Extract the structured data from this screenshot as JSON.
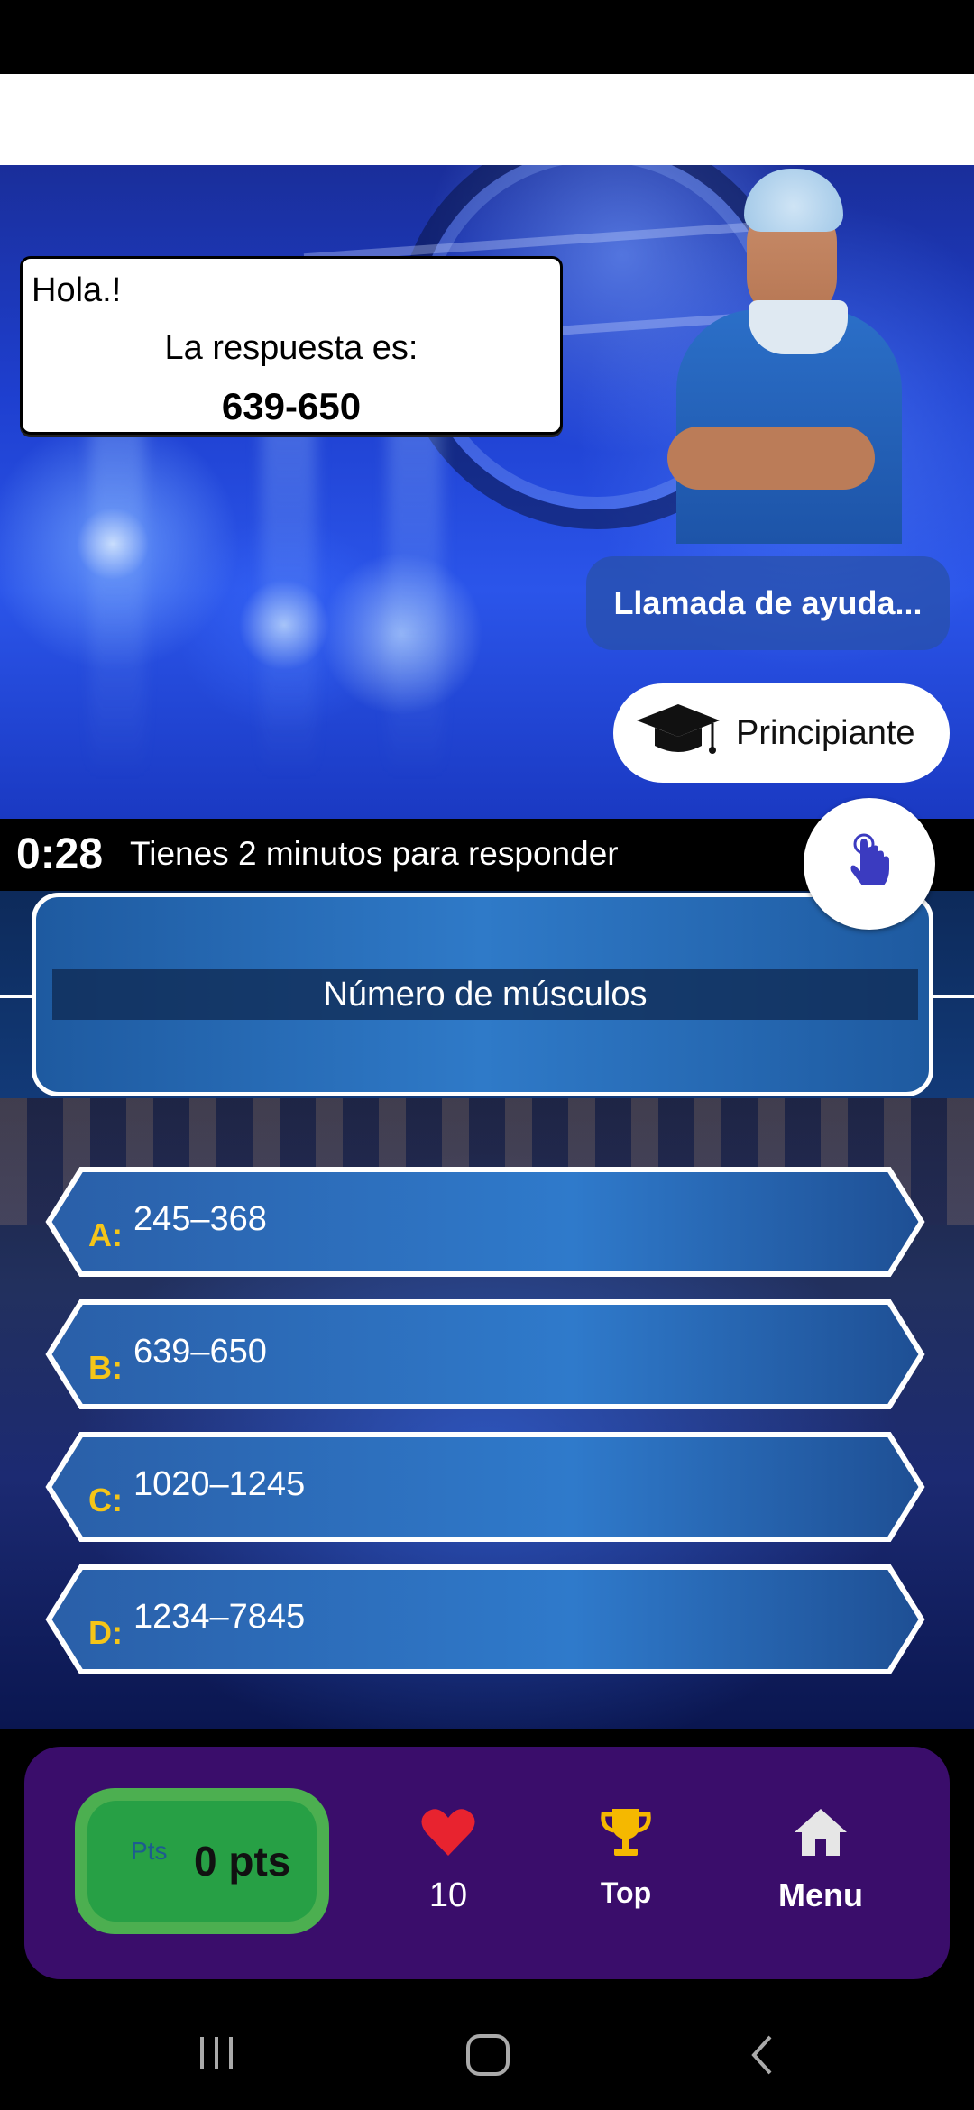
{
  "dialog": {
    "greeting": "Hola.!",
    "prompt": "La respuesta es:",
    "answer": "639-650"
  },
  "help_button_label": "Llamada de ayuda...",
  "level": {
    "icon": "graduation-cap-icon",
    "label": "Principiante"
  },
  "timer": {
    "value": "0:28",
    "message": "Tienes 2 minutos para responder"
  },
  "question": "Número de músculos",
  "answers": [
    {
      "letter": "A:",
      "text": "245–368"
    },
    {
      "letter": "B:",
      "text": "639–650"
    },
    {
      "letter": "C:",
      "text": "1020–1245"
    },
    {
      "letter": "D:",
      "text": "1234–7845"
    }
  ],
  "bottom_nav": {
    "points_small": "Pts",
    "points_value": "0 pts",
    "lives": "10",
    "top_label": "Top",
    "menu_label": "Menu"
  },
  "colors": {
    "answer_letter": "#f5c518",
    "nav_panel": "#3a0d6b",
    "points_button": "#4caf50",
    "heart": "#e8232f",
    "trophy": "#f5b800"
  }
}
